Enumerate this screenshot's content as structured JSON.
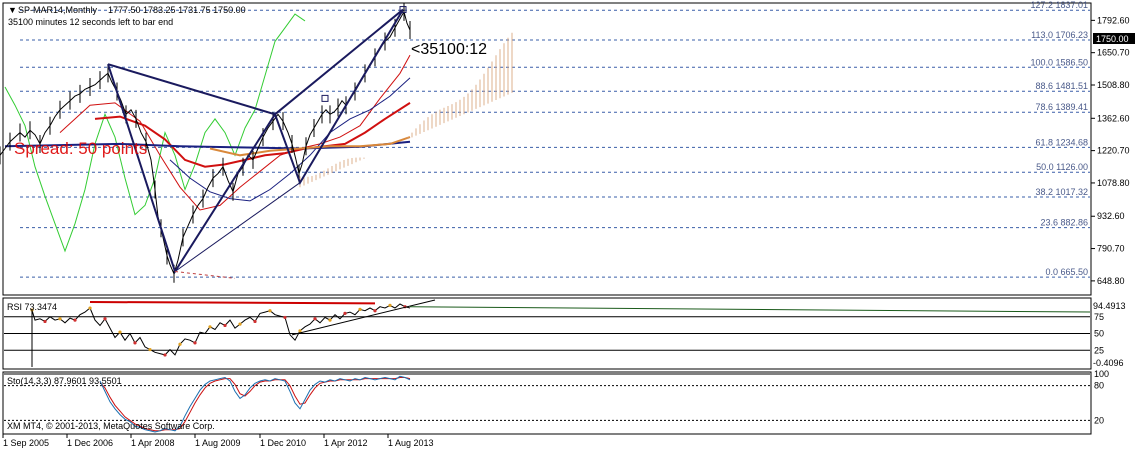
{
  "chart_data": [
    {
      "type": "candlestick",
      "header": {
        "symbol": "SP-MAR14,Monthly",
        "ohlc": "1777.50 1783.25 1731.75 1750.00",
        "timer": "35100 minutes 12 seconds left to bar end"
      },
      "overlay": {
        "spread": "Spread: 50 points",
        "countdown": "<35100:12",
        "current_price": "1750.00"
      },
      "y_ticks": [
        "1792.60",
        "1650.70",
        "1508.80",
        "1362.60",
        "1220.70",
        "1078.80",
        "932.60",
        "790.70",
        "648.80"
      ],
      "fib_levels": [
        {
          "label": "127.2  1837.01",
          "value": 1837.01
        },
        {
          "label": "113.0  1706.23",
          "value": 1706.23
        },
        {
          "label": "100.0  1586.50",
          "value": 1586.5
        },
        {
          "label": "88.6  1481.51",
          "value": 1481.51
        },
        {
          "label": "78.6  1389.41",
          "value": 1389.41
        },
        {
          "label": "61.8  1234.68",
          "value": 1234.68
        },
        {
          "label": "50.0  1126.00",
          "value": 1126.0
        },
        {
          "label": "38.2  1017.32",
          "value": 1017.32
        },
        {
          "label": "23.6  882.86",
          "value": 882.86
        },
        {
          "label": "0.0  665.50",
          "value": 665.5
        }
      ],
      "ylim": [
        648.8,
        1860
      ],
      "price_points": [
        [
          0,
          1200
        ],
        [
          5,
          1230
        ],
        [
          10,
          1260
        ],
        [
          15,
          1280
        ],
        [
          20,
          1300
        ],
        [
          25,
          1280
        ],
        [
          30,
          1310
        ],
        [
          35,
          1290
        ],
        [
          40,
          1250
        ],
        [
          45,
          1300
        ],
        [
          50,
          1330
        ],
        [
          55,
          1370
        ],
        [
          60,
          1400
        ],
        [
          65,
          1420
        ],
        [
          70,
          1440
        ],
        [
          75,
          1460
        ],
        [
          80,
          1470
        ],
        [
          85,
          1490
        ],
        [
          90,
          1500
        ],
        [
          95,
          1510
        ],
        [
          100,
          1530
        ],
        [
          105,
          1550
        ],
        [
          108,
          1560
        ],
        [
          112,
          1520
        ],
        [
          117,
          1480
        ],
        [
          121,
          1440
        ],
        [
          126,
          1380
        ],
        [
          131,
          1400
        ],
        [
          136,
          1360
        ],
        [
          141,
          1300
        ],
        [
          146,
          1260
        ],
        [
          151,
          1180
        ],
        [
          155,
          1050
        ],
        [
          158,
          930
        ],
        [
          161,
          880
        ],
        [
          164,
          820
        ],
        [
          167,
          760
        ],
        [
          170,
          720
        ],
        [
          174,
          680
        ],
        [
          178,
          740
        ],
        [
          183,
          840
        ],
        [
          188,
          890
        ],
        [
          193,
          940
        ],
        [
          198,
          980
        ],
        [
          203,
          1010
        ],
        [
          208,
          1060
        ],
        [
          213,
          1100
        ],
        [
          218,
          1120
        ],
        [
          223,
          1150
        ],
        [
          228,
          1090
        ],
        [
          233,
          1040
        ],
        [
          238,
          1120
        ],
        [
          243,
          1150
        ],
        [
          248,
          1200
        ],
        [
          253,
          1180
        ],
        [
          258,
          1230
        ],
        [
          263,
          1280
        ],
        [
          268,
          1320
        ],
        [
          273,
          1350
        ],
        [
          278,
          1380
        ],
        [
          283,
          1350
        ],
        [
          288,
          1300
        ],
        [
          292,
          1250
        ],
        [
          296,
          1180
        ],
        [
          299,
          1120
        ],
        [
          302,
          1160
        ],
        [
          306,
          1240
        ],
        [
          310,
          1290
        ],
        [
          314,
          1320
        ],
        [
          318,
          1350
        ],
        [
          322,
          1380
        ],
        [
          326,
          1400
        ],
        [
          330,
          1380
        ],
        [
          334,
          1390
        ],
        [
          338,
          1410
        ],
        [
          342,
          1440
        ],
        [
          346,
          1420
        ],
        [
          350,
          1450
        ],
        [
          355,
          1480
        ],
        [
          360,
          1520
        ],
        [
          365,
          1560
        ],
        [
          370,
          1600
        ],
        [
          375,
          1630
        ],
        [
          380,
          1670
        ],
        [
          385,
          1700
        ],
        [
          390,
          1720
        ],
        [
          395,
          1760
        ],
        [
          400,
          1800
        ],
        [
          404,
          1830
        ],
        [
          407,
          1780
        ],
        [
          410,
          1750
        ]
      ],
      "rsi_panel": {
        "title": "RSI 73.3474",
        "ylim": [
          0,
          100
        ],
        "levels": [
          "75",
          "50",
          "25"
        ],
        "top_label": "94.4913",
        "bottom_label": "-0.4096",
        "points": [
          [
            32,
            85
          ],
          [
            35,
            70
          ],
          [
            40,
            72
          ],
          [
            45,
            68
          ],
          [
            50,
            75
          ],
          [
            55,
            70
          ],
          [
            60,
            72
          ],
          [
            65,
            66
          ],
          [
            70,
            73
          ],
          [
            75,
            70
          ],
          [
            80,
            78
          ],
          [
            85,
            82
          ],
          [
            90,
            88
          ],
          [
            95,
            70
          ],
          [
            100,
            62
          ],
          [
            105,
            72
          ],
          [
            110,
            58
          ],
          [
            115,
            44
          ],
          [
            120,
            52
          ],
          [
            125,
            40
          ],
          [
            130,
            50
          ],
          [
            135,
            36
          ],
          [
            140,
            44
          ],
          [
            145,
            30
          ],
          [
            150,
            26
          ],
          [
            155,
            22
          ],
          [
            160,
            20
          ],
          [
            165,
            18
          ],
          [
            170,
            26
          ],
          [
            175,
            18
          ],
          [
            180,
            34
          ],
          [
            185,
            42
          ],
          [
            190,
            40
          ],
          [
            195,
            36
          ],
          [
            200,
            52
          ],
          [
            205,
            50
          ],
          [
            210,
            60
          ],
          [
            215,
            56
          ],
          [
            220,
            66
          ],
          [
            225,
            62
          ],
          [
            230,
            70
          ],
          [
            235,
            58
          ],
          [
            240,
            64
          ],
          [
            245,
            70
          ],
          [
            250,
            74
          ],
          [
            255,
            68
          ],
          [
            260,
            80
          ],
          [
            265,
            82
          ],
          [
            270,
            84
          ],
          [
            275,
            78
          ],
          [
            280,
            76
          ],
          [
            285,
            74
          ],
          [
            290,
            48
          ],
          [
            295,
            40
          ],
          [
            300,
            54
          ],
          [
            305,
            60
          ],
          [
            310,
            64
          ],
          [
            315,
            72
          ],
          [
            320,
            66
          ],
          [
            325,
            74
          ],
          [
            330,
            70
          ],
          [
            335,
            78
          ],
          [
            340,
            72
          ],
          [
            345,
            80
          ],
          [
            350,
            82
          ],
          [
            355,
            78
          ],
          [
            360,
            86
          ],
          [
            365,
            84
          ],
          [
            370,
            88
          ],
          [
            375,
            84
          ],
          [
            380,
            90
          ],
          [
            385,
            88
          ],
          [
            390,
            92
          ],
          [
            395,
            88
          ],
          [
            400,
            94
          ],
          [
            405,
            90
          ],
          [
            410,
            88
          ]
        ]
      },
      "sto_panel": {
        "title": "Sto(14,3,3) 87.9601 93.5501",
        "ylim": [
          0,
          100
        ],
        "levels": [
          "100",
          "80",
          "20"
        ],
        "k_points": [
          [
            100,
            88
          ],
          [
            105,
            70
          ],
          [
            110,
            52
          ],
          [
            115,
            40
          ],
          [
            120,
            30
          ],
          [
            125,
            22
          ],
          [
            130,
            18
          ],
          [
            135,
            10
          ],
          [
            140,
            8
          ],
          [
            145,
            4
          ],
          [
            150,
            2
          ],
          [
            155,
            0
          ],
          [
            160,
            2
          ],
          [
            165,
            6
          ],
          [
            170,
            4
          ],
          [
            175,
            2
          ],
          [
            180,
            10
          ],
          [
            185,
            28
          ],
          [
            190,
            44
          ],
          [
            195,
            58
          ],
          [
            200,
            72
          ],
          [
            205,
            82
          ],
          [
            210,
            88
          ],
          [
            215,
            90
          ],
          [
            220,
            92
          ],
          [
            225,
            94
          ],
          [
            230,
            88
          ],
          [
            235,
            70
          ],
          [
            240,
            58
          ],
          [
            245,
            64
          ],
          [
            250,
            76
          ],
          [
            255,
            84
          ],
          [
            260,
            88
          ],
          [
            265,
            90
          ],
          [
            270,
            88
          ],
          [
            275,
            92
          ],
          [
            280,
            90
          ],
          [
            285,
            88
          ],
          [
            290,
            70
          ],
          [
            295,
            50
          ],
          [
            300,
            40
          ],
          [
            305,
            56
          ],
          [
            310,
            72
          ],
          [
            315,
            82
          ],
          [
            320,
            88
          ],
          [
            325,
            86
          ],
          [
            330,
            90
          ],
          [
            335,
            88
          ],
          [
            340,
            92
          ],
          [
            345,
            90
          ],
          [
            350,
            88
          ],
          [
            355,
            92
          ],
          [
            360,
            90
          ],
          [
            365,
            94
          ],
          [
            370,
            92
          ],
          [
            375,
            90
          ],
          [
            380,
            92
          ],
          [
            385,
            94
          ],
          [
            390,
            92
          ],
          [
            395,
            90
          ],
          [
            400,
            96
          ],
          [
            405,
            94
          ],
          [
            410,
            90
          ]
        ],
        "d_points": [
          [
            100,
            86
          ],
          [
            105,
            76
          ],
          [
            110,
            60
          ],
          [
            115,
            46
          ],
          [
            120,
            36
          ],
          [
            125,
            26
          ],
          [
            130,
            20
          ],
          [
            135,
            14
          ],
          [
            140,
            10
          ],
          [
            145,
            6
          ],
          [
            150,
            4
          ],
          [
            155,
            2
          ],
          [
            160,
            2
          ],
          [
            165,
            4
          ],
          [
            170,
            4
          ],
          [
            175,
            4
          ],
          [
            180,
            6
          ],
          [
            185,
            18
          ],
          [
            190,
            34
          ],
          [
            195,
            50
          ],
          [
            200,
            64
          ],
          [
            205,
            76
          ],
          [
            210,
            84
          ],
          [
            215,
            88
          ],
          [
            220,
            90
          ],
          [
            225,
            92
          ],
          [
            230,
            92
          ],
          [
            235,
            82
          ],
          [
            240,
            66
          ],
          [
            245,
            62
          ],
          [
            250,
            70
          ],
          [
            255,
            80
          ],
          [
            260,
            86
          ],
          [
            265,
            88
          ],
          [
            270,
            88
          ],
          [
            275,
            90
          ],
          [
            280,
            90
          ],
          [
            285,
            90
          ],
          [
            290,
            80
          ],
          [
            295,
            62
          ],
          [
            300,
            48
          ],
          [
            305,
            50
          ],
          [
            310,
            64
          ],
          [
            315,
            76
          ],
          [
            320,
            84
          ],
          [
            325,
            86
          ],
          [
            330,
            88
          ],
          [
            335,
            88
          ],
          [
            340,
            90
          ],
          [
            345,
            90
          ],
          [
            350,
            90
          ],
          [
            355,
            90
          ],
          [
            360,
            90
          ],
          [
            365,
            92
          ],
          [
            370,
            92
          ],
          [
            375,
            92
          ],
          [
            380,
            92
          ],
          [
            385,
            92
          ],
          [
            390,
            92
          ],
          [
            395,
            92
          ],
          [
            400,
            94
          ],
          [
            405,
            94
          ],
          [
            410,
            92
          ]
        ]
      },
      "x_ticks": [
        "1 Sep 2005",
        "1 Dec 2006",
        "1 Apr 2008",
        "1 Aug 2009",
        "1 Dec 2010",
        "1 Apr 2012",
        "1 Aug 2013"
      ],
      "footer": "XM MT4, © 2001-2013, MetaQuotes Software Corp.",
      "colors": {
        "price": "#000000",
        "pattern": "#1a1a5e",
        "ichimoku_green": "#33cc33",
        "fib_line": "#3a5fa8",
        "ma_red": "#d01010",
        "ma_navy": "#1a2080",
        "ma_orange": "#d9883a",
        "cloud": "#d7a27a",
        "rsi_trend": "#cc0000",
        "sto_k": "#1a6fb0",
        "sto_d": "#cc1010",
        "price_label_bg": "#000000",
        "price_label_fg": "#ffffff"
      }
    }
  ]
}
